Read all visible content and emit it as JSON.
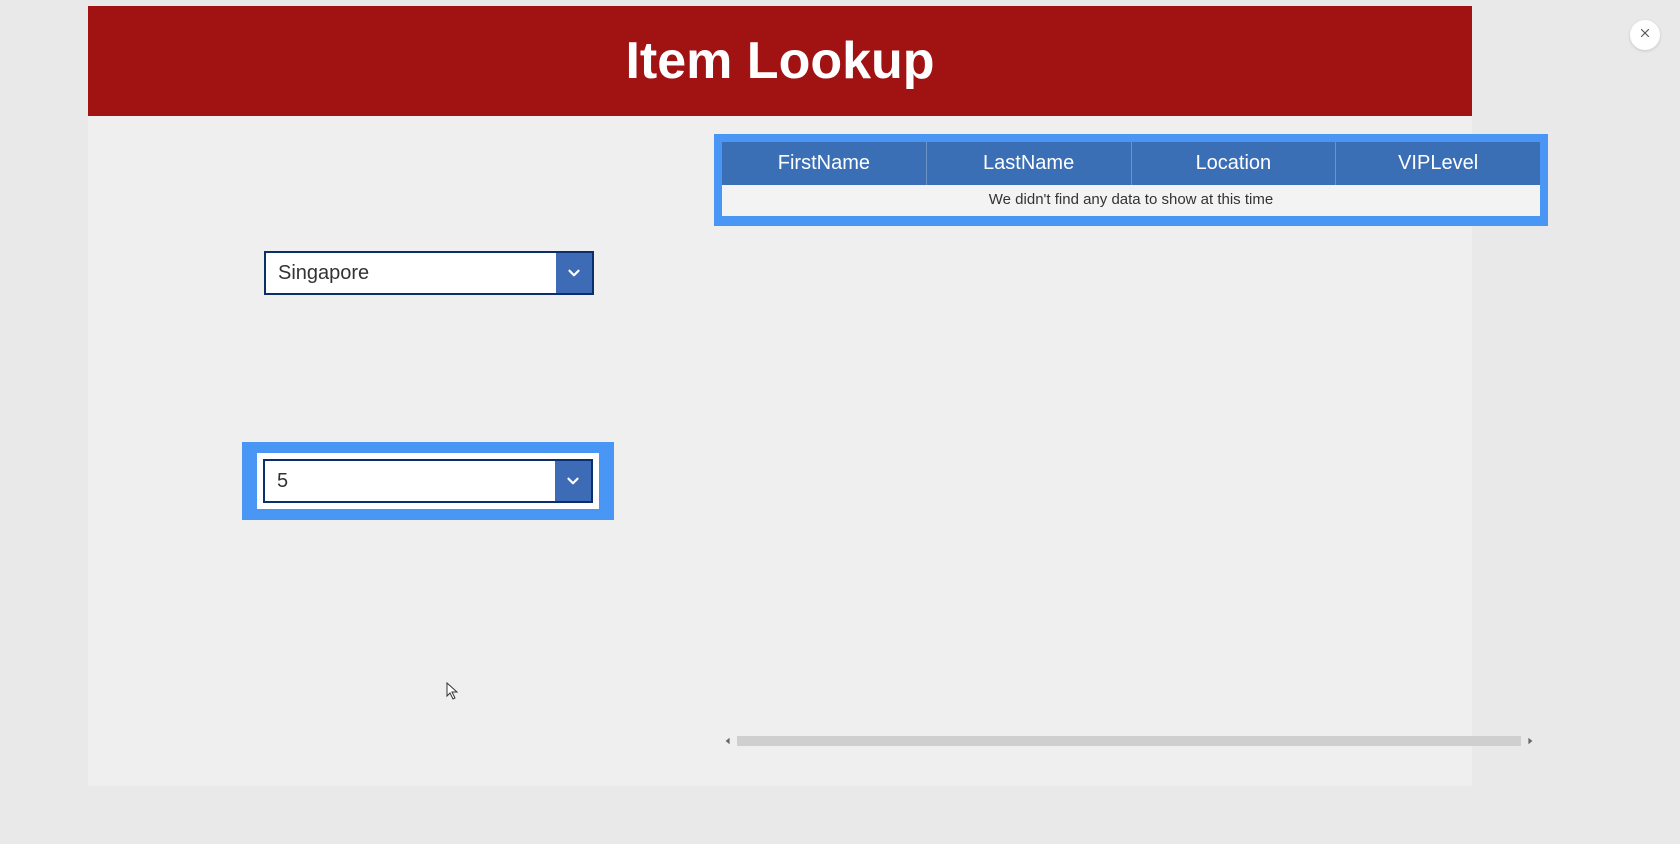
{
  "header": {
    "title": "Item Lookup"
  },
  "filters": {
    "location_select": "Singapore",
    "vip_select": "5"
  },
  "table": {
    "columns": [
      "FirstName",
      "LastName",
      "Location",
      "VIPLevel"
    ],
    "empty_message": "We didn't find any data to show at this time"
  }
}
